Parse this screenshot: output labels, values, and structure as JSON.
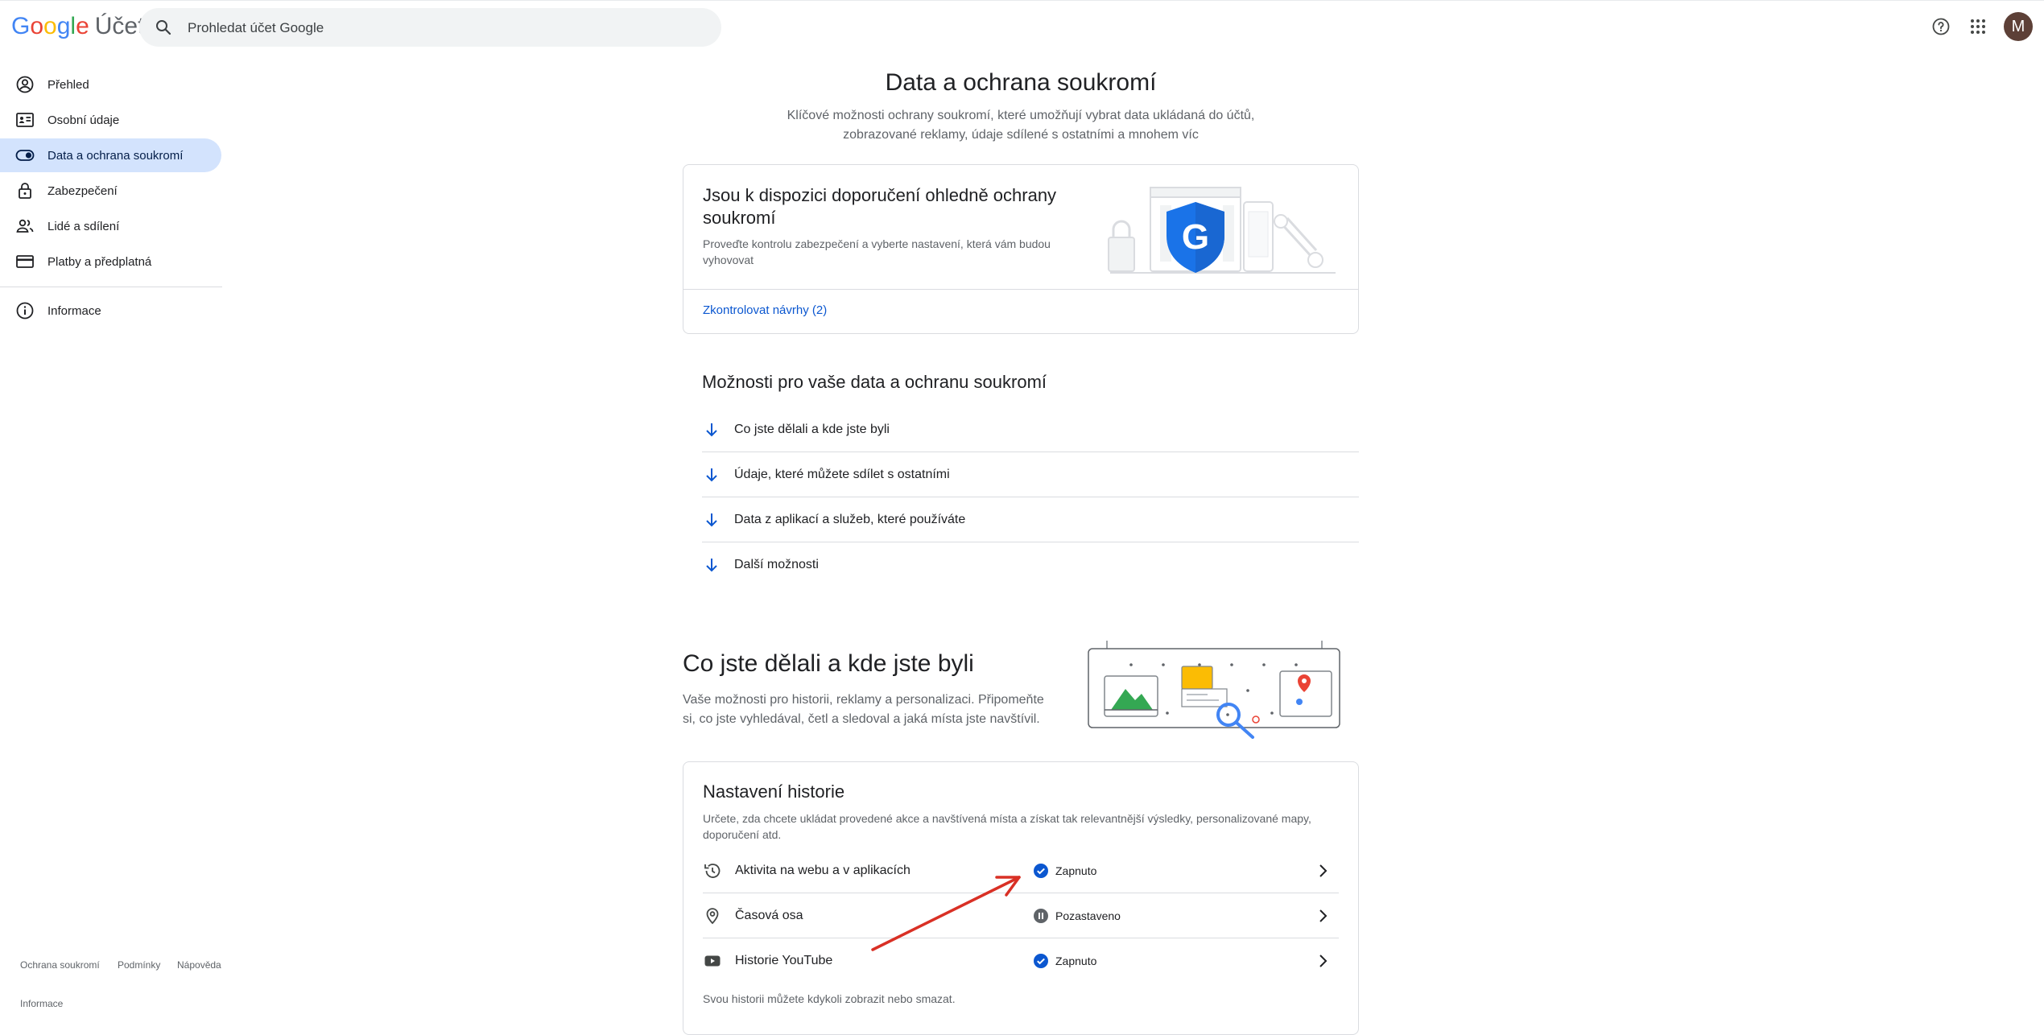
{
  "header": {
    "logo_word": "Google",
    "product_name": "Účet",
    "search_placeholder": "Prohledat účet Google",
    "avatar_initial": "M",
    "icons": [
      "search-icon",
      "help-icon",
      "apps-grid-icon"
    ]
  },
  "sidebar": {
    "items": [
      {
        "label": "Přehled",
        "icon": "account-circle-icon"
      },
      {
        "label": "Osobní údaje",
        "icon": "id-card-icon"
      },
      {
        "label": "Data a ochrana soukromí",
        "icon": "toggle-icon",
        "active": true
      },
      {
        "label": "Zabezpečení",
        "icon": "lock-icon"
      },
      {
        "label": "Lidé a sdílení",
        "icon": "people-icon"
      },
      {
        "label": "Platby a předplatná",
        "icon": "credit-card-icon"
      },
      {
        "label": "Informace",
        "icon": "info-icon"
      }
    ],
    "footer": {
      "privacy": "Ochrana soukromí",
      "terms": "Podmínky",
      "help": "Nápověda",
      "about": "Informace"
    }
  },
  "main": {
    "title": "Data a ochrana soukromí",
    "subtitle": "Klíčové možnosti ochrany soukromí, které umožňují vybrat data ukládaná do účtů, zobrazované reklamy, údaje sdílené s ostatními a mnohem víc",
    "recommendation_card": {
      "title": "Jsou k dispozici doporučení ohledně ochrany soukromí",
      "description": "Proveďte kontrolu zabezpečení a vyberte nastavení, která vám budou vyhovovat",
      "link": "Zkontrolovat návrhy (2)"
    },
    "options": {
      "title": "Možnosti pro vaše data a ochranu soukromí",
      "items": [
        "Co jste dělali a kde jste byli",
        "Údaje, které můžete sdílet s ostatními",
        "Data z aplikací a služeb, které používáte",
        "Další možnosti"
      ]
    },
    "activity_section": {
      "title": "Co jste dělali a kde jste byli",
      "description": "Vaše možnosti pro historii, reklamy a personalizaci. Připomeňte si, co jste vyhledával, četl a sledoval a jaká místa jste navštívil."
    },
    "history_card": {
      "title": "Nastavení historie",
      "description": "Určete, zda chcete ukládat provedené akce a navštívená místa a získat tak relevantnější výsledky, personalizované mapy, doporučení atd.",
      "rows": [
        {
          "label": "Aktivita na webu a v aplikacích",
          "status": "Zapnuto",
          "icon": "history-icon",
          "status_icon": "check-circle-icon"
        },
        {
          "label": "Časová osa",
          "status": "Pozastaveno",
          "icon": "location-pin-icon",
          "status_icon": "pause-circle-icon"
        },
        {
          "label": "Historie YouTube",
          "status": "Zapnuto",
          "icon": "youtube-icon",
          "status_icon": "check-circle-icon"
        }
      ],
      "footer": "Svou historii můžete kdykoli zobrazit nebo smazat."
    }
  },
  "colors": {
    "accent_blue": "#0b57d0",
    "active_nav_bg": "#d3e3fd",
    "annotation_red": "#d93025"
  }
}
